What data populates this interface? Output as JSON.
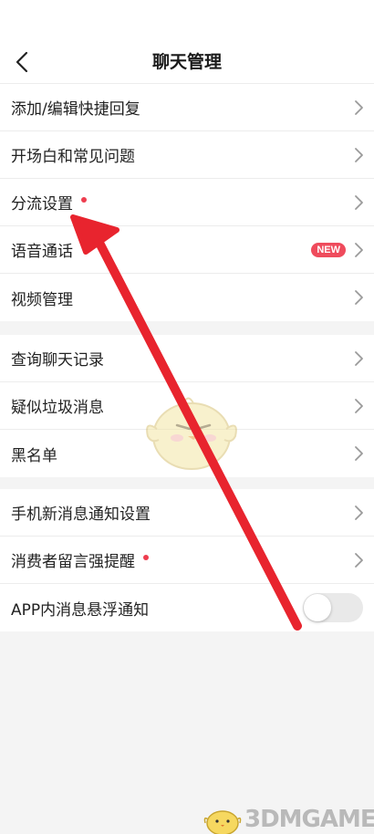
{
  "header": {
    "title": "聊天管理",
    "back_icon": "chevron-left-icon"
  },
  "groups": [
    {
      "items": [
        {
          "label": "添加/编辑快捷回复",
          "red_dot": false,
          "control": "chevron"
        },
        {
          "label": "开场白和常见问题",
          "red_dot": false,
          "control": "chevron"
        },
        {
          "label": "分流设置",
          "red_dot": true,
          "control": "chevron"
        },
        {
          "label": "语音通话",
          "red_dot": false,
          "badge": "NEW",
          "control": "chevron"
        },
        {
          "label": "视频管理",
          "red_dot": false,
          "control": "chevron"
        }
      ]
    },
    {
      "items": [
        {
          "label": "查询聊天记录",
          "red_dot": false,
          "control": "chevron"
        },
        {
          "label": "疑似垃圾消息",
          "red_dot": false,
          "control": "chevron"
        },
        {
          "label": "黑名单",
          "red_dot": false,
          "control": "chevron"
        }
      ]
    },
    {
      "items": [
        {
          "label": "手机新消息通知设置",
          "red_dot": false,
          "control": "chevron"
        },
        {
          "label": "消费者留言强提醒",
          "red_dot": true,
          "control": "chevron"
        },
        {
          "label": "APP内消息悬浮通知",
          "red_dot": false,
          "control": "toggle",
          "toggle_on": false
        }
      ]
    }
  ],
  "colors": {
    "accent_red": "#ee3d4f",
    "badge_red": "#ef4b5c",
    "annotation_arrow": "#e8242e",
    "page_background": "#f4f4f4",
    "chevron": "#9a9a9a"
  },
  "watermark": {
    "logo_text": "3DMGAME",
    "mascot_icon": "chick-mascot-icon"
  }
}
